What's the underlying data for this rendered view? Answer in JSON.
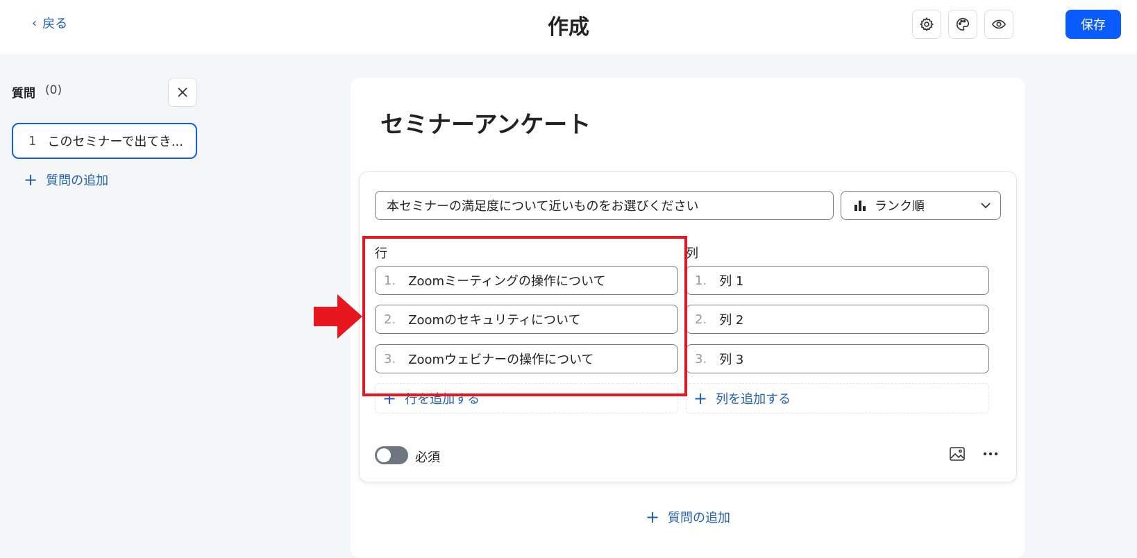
{
  "header": {
    "back_label": "戻る",
    "title": "作成",
    "save_label": "保存"
  },
  "sidebar": {
    "title": "質問",
    "count": "(0)",
    "items": [
      {
        "number": "1",
        "text": "このセミナーで出てき..."
      }
    ],
    "add_label": "質問の追加"
  },
  "survey": {
    "title": "セミナーアンケート",
    "question": {
      "text": "本セミナーの満足度について近いものをお選びください",
      "type_label": "ランク順",
      "rows_label": "行",
      "columns_label": "列",
      "rows": [
        {
          "number": "1.",
          "text": "Zoomミーティングの操作について"
        },
        {
          "number": "2.",
          "text": "Zoomのセキュリティについて"
        },
        {
          "number": "3.",
          "text": "Zoomウェビナーの操作について"
        }
      ],
      "columns": [
        {
          "number": "1.",
          "text": "列 1"
        },
        {
          "number": "2.",
          "text": "列 2"
        },
        {
          "number": "3.",
          "text": "列 3"
        }
      ],
      "add_row_label": "行を追加する",
      "add_column_label": "列を追加する",
      "required_label": "必須",
      "required": false
    },
    "add_question_label": "質問の追加"
  },
  "colors": {
    "accent": "#0b5cff",
    "link": "#1e5fb4",
    "highlight": "#e8161e"
  }
}
